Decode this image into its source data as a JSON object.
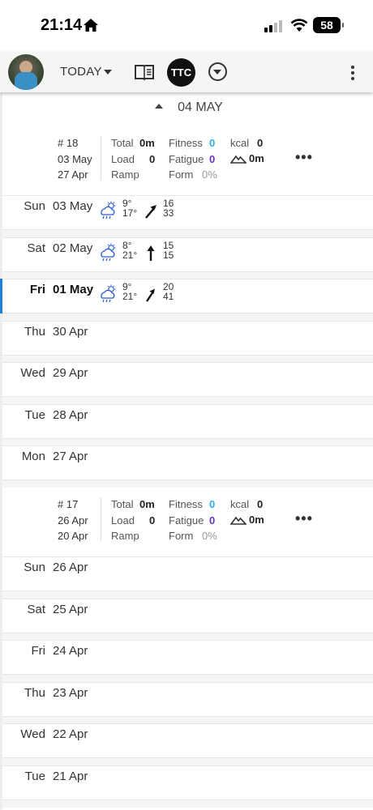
{
  "status": {
    "time": "21:14",
    "battery": "58"
  },
  "appbar": {
    "today_label": "TODAY",
    "logo_text": "TTC"
  },
  "month_header": "04 MAY",
  "weeks": [
    {
      "number": "# 18",
      "end": "03 May",
      "start": "27 Apr",
      "total_label": "Total",
      "total_value": "0m",
      "load_label": "Load",
      "load_value": "0",
      "ramp_label": "Ramp",
      "fitness_label": "Fitness",
      "fitness_value": "0",
      "fatigue_label": "Fatigue",
      "fatigue_value": "0",
      "form_label": "Form",
      "form_value": "0%",
      "kcal_label": "kcal",
      "kcal_value": "0",
      "elev_value": "0m",
      "more": "•••"
    },
    {
      "number": "# 17",
      "end": "26 Apr",
      "start": "20 Apr",
      "total_label": "Total",
      "total_value": "0m",
      "load_label": "Load",
      "load_value": "0",
      "ramp_label": "Ramp",
      "fitness_label": "Fitness",
      "fitness_value": "0",
      "fatigue_label": "Fatigue",
      "fatigue_value": "0",
      "form_label": "Form",
      "form_value": "0%",
      "kcal_label": "kcal",
      "kcal_value": "0",
      "elev_value": "0m",
      "more": "•••"
    }
  ],
  "days": [
    {
      "name": "Sun",
      "date": "03 May",
      "temp_high": "9°",
      "temp_low": "17°",
      "wind_a": "16",
      "wind_b": "33",
      "icon": "cloud-sun-rain-icon",
      "wind_dir": "north-east"
    },
    {
      "name": "Sat",
      "date": "02 May",
      "temp_high": "8°",
      "temp_low": "21°",
      "wind_a": "15",
      "wind_b": "15",
      "icon": "cloud-sun-rain-icon",
      "wind_dir": "north"
    },
    {
      "name": "Fri",
      "date": "01 May",
      "temp_high": "9°",
      "temp_low": "21°",
      "wind_a": "20",
      "wind_b": "41",
      "icon": "cloud-sun-rain-icon",
      "wind_dir": "north-east",
      "selected": true
    },
    {
      "name": "Thu",
      "date": "30 Apr"
    },
    {
      "name": "Wed",
      "date": "29 Apr"
    },
    {
      "name": "Tue",
      "date": "28 Apr"
    },
    {
      "name": "Mon",
      "date": "27 Apr"
    },
    {
      "name": "Sun",
      "date": "26 Apr"
    },
    {
      "name": "Sat",
      "date": "25 Apr"
    },
    {
      "name": "Fri",
      "date": "24 Apr"
    },
    {
      "name": "Thu",
      "date": "23 Apr"
    },
    {
      "name": "Wed",
      "date": "22 Apr"
    },
    {
      "name": "Tue",
      "date": "21 Apr"
    }
  ],
  "colors": {
    "fitness": "#2aaee0",
    "fatigue": "#6b2fbf",
    "selected_bar": "#1e7fd6",
    "weather_icon": "#2a5bd7"
  }
}
